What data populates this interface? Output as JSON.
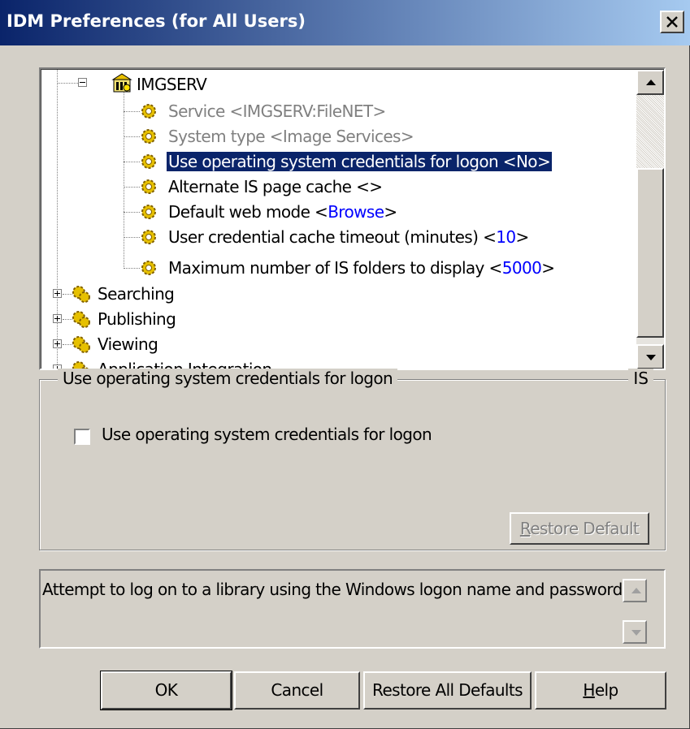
{
  "window": {
    "title": "IDM Preferences (for All Users)",
    "close_label": "×"
  },
  "tree": {
    "root": {
      "label": "IMGSERV"
    },
    "children": [
      {
        "label": "Service <IMGSERV:FileNET>",
        "disabled": true
      },
      {
        "label": "System type <Image Services>",
        "disabled": true
      },
      {
        "label": "Use operating system credentials for logon <No>",
        "selected": true
      },
      {
        "label": "Alternate IS page cache <>"
      },
      {
        "prefix": "Default web mode <",
        "value": "Browse",
        "suffix": ">"
      },
      {
        "prefix": "User credential cache timeout (minutes) <",
        "value": "10",
        "suffix": ">"
      },
      {
        "prefix": "Maximum number of IS folders to display <",
        "value": "5000",
        "suffix": ">"
      }
    ],
    "groups": [
      {
        "label": "Searching"
      },
      {
        "label": "Publishing"
      },
      {
        "label": "Viewing"
      },
      {
        "label": "Application Integration"
      }
    ]
  },
  "settings_group": {
    "title": "Use operating system credentials for logon",
    "tag": "IS",
    "checkbox_label": "Use operating system credentials for logon",
    "checkbox_checked": false,
    "restore_default": {
      "label_underlined": "R",
      "label_rest": "estore Default"
    }
  },
  "description": "Attempt to log on to a library using the Windows logon name and password.",
  "buttons": {
    "ok": "OK",
    "cancel": "Cancel",
    "restore_all": "Restore All Defaults",
    "help_underlined": "H",
    "help_rest": "elp"
  }
}
